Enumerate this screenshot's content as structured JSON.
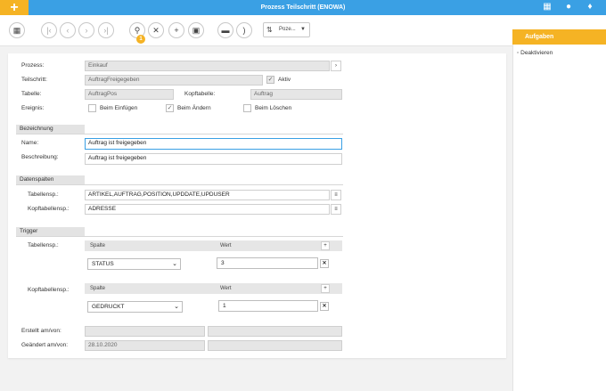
{
  "window": {
    "title": "Prozess Teilschritt (ENOWA)"
  },
  "toolbar": {
    "badge_count": "1",
    "select_label": "Poze..."
  },
  "form": {
    "prozess_label": "Prozess:",
    "prozess_value": "Einkauf",
    "teilschritt_label": "Teilschritt:",
    "teilschritt_value": "AuftragFreigegeben",
    "aktiv_label": "Aktiv",
    "tabelle_label": "Tabelle:",
    "tabelle_value": "AuftragPos",
    "kopftabelle_label": "Kopftabelle:",
    "kopftabelle_value": "Auftrag",
    "ereignis_label": "Ereignis:",
    "beim_einfuegen": "Beim Einfügen",
    "beim_aendern": "Beim Ändern",
    "beim_loeschen": "Beim Löschen"
  },
  "bezeichnung": {
    "section": "Bezeichnung",
    "name_label": "Name:",
    "name_value": "Auftrag ist freigegeben",
    "beschreibung_label": "Beschreibung:",
    "beschreibung_value": "Auftrag ist freigegeben"
  },
  "datenspalten": {
    "section": "Datenspalten",
    "tabellensp_label": "Tabellensp.:",
    "tabellensp_value": "ARTIKEL,AUFTRAG,POSITION,UPDDATE,UPDUSER",
    "kopftabellensp_label": "Kopftabellensp.:",
    "kopftabellensp_value": "ADRESSE"
  },
  "trigger": {
    "section": "Trigger",
    "tabellensp_label": "Tabellensp.:",
    "kopftabellensp_label": "Kopftabellensp.:",
    "col_spalte": "Spalte",
    "col_wert": "Wert",
    "row1_spalte": "STATUS",
    "row1_wert": "3",
    "row2_spalte": "GEDRUCKT",
    "row2_wert": "1"
  },
  "meta": {
    "erstellt_label": "Erstellt am/von:",
    "geaendert_label": "Geändert am/von:",
    "geaendert_value": "28.10.2020"
  },
  "aufgaben": {
    "title": "Aufgaben",
    "items": [
      "Deaktivieren"
    ]
  }
}
